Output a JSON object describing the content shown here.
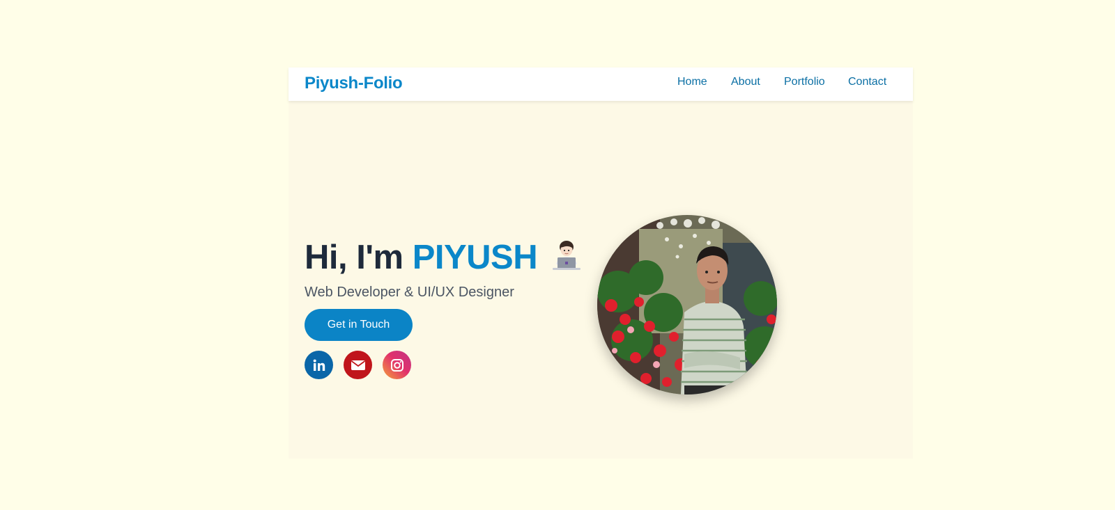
{
  "navbar": {
    "brand": "Piyush-Folio",
    "links": [
      {
        "label": "Home"
      },
      {
        "label": "About"
      },
      {
        "label": "Portfolio"
      },
      {
        "label": "Contact"
      }
    ]
  },
  "hero": {
    "greeting": "Hi, I'm ",
    "name": "PIYUSH",
    "emoji_icon": "technologist-icon",
    "subtitle": "Web Developer & UI/UX Designer",
    "cta_label": "Get in Touch",
    "socials": [
      {
        "icon": "linkedin-icon",
        "color": "#0a66a8"
      },
      {
        "icon": "envelope-icon",
        "color": "#c0151b"
      },
      {
        "icon": "instagram-icon",
        "color": "#e1306c"
      }
    ],
    "portrait_alt": "profile-photo"
  },
  "colors": {
    "accent": "#0b87c9",
    "background": "#fffee8",
    "heading": "#1e2a3b"
  }
}
